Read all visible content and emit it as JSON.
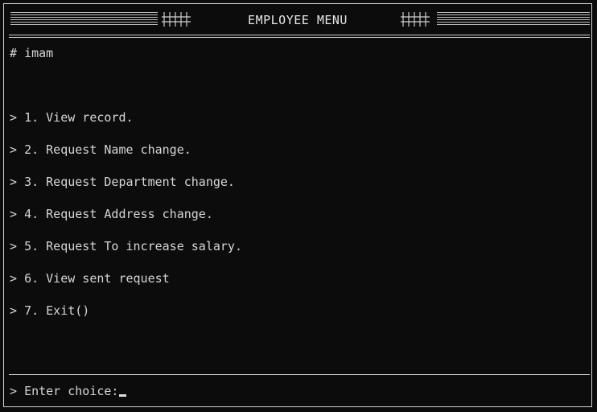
{
  "header": {
    "title": "EMPLOYEE MENU",
    "ornament_left_icon": "hash-fence-icon",
    "ornament_right_icon": "hash-fence-icon"
  },
  "session": {
    "prompt_symbol": "#",
    "username": "imam"
  },
  "menu": {
    "bullet": ">",
    "items": [
      {
        "label": "1. View record."
      },
      {
        "label": "2. Request Name change."
      },
      {
        "label": "3. Request Department change."
      },
      {
        "label": "4. Request Address change."
      },
      {
        "label": "5. Request To increase salary."
      },
      {
        "label": "6. View sent request"
      },
      {
        "label": "7. Exit()"
      }
    ]
  },
  "input": {
    "bullet": ">",
    "label": "Enter choice:",
    "value": ""
  },
  "colors": {
    "background": "#0c0c0c",
    "text": "#d6d6d6",
    "rule": "#cfcfcf"
  }
}
